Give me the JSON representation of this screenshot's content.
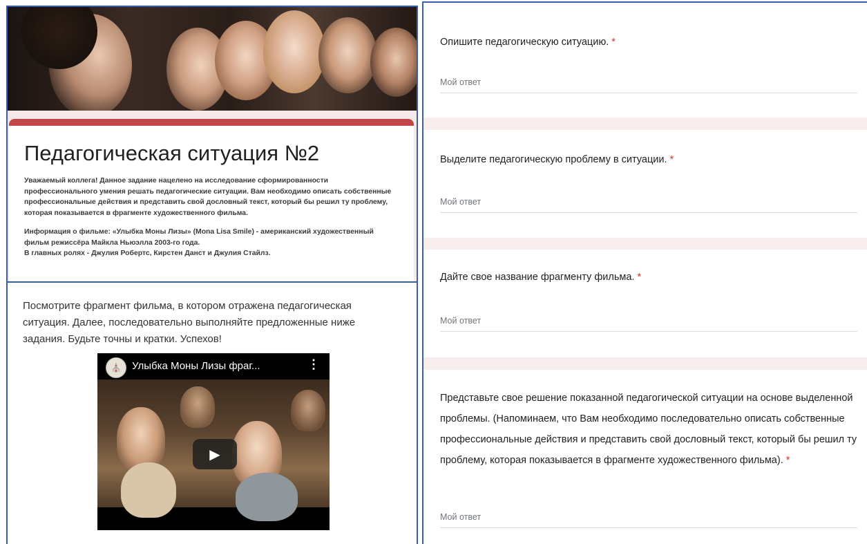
{
  "form": {
    "title": "Педагогическая ситуация №2",
    "description": [
      "Уважаемый коллега! Данное задание нацелено на исследование сформированности профессионального умения решать педагогические ситуации.   Вам необходимо описать собственные профессиональные действия и представить свой дословный текст, который бы решил ту проблему, которая показывается в фрагменте художественного фильма.",
      "Информация о фильме: «Улыбка Моны Лизы» (Mona Lisa Smile) - американский художественный фильм режиссёра Майкла Ньюэлла 2003-го года.\nВ главных ролях - Джулия Робертс, Кирстен Данст и Джулия Стайлз."
    ],
    "accent_color": "#c0464a"
  },
  "intro": {
    "text": "Посмотрите фрагмент фильма, в котором отражена педагогическая ситуация. Далее, последовательно выполняйте предложенные ниже задания. Будьте точны и кратки. Успехов!"
  },
  "video": {
    "title": "Улыбка Моны Лизы фраг...",
    "menu_icon": "more-vert-icon",
    "play_icon": "play-icon"
  },
  "questions": [
    {
      "label": "Опишите педагогическую ситуацию.",
      "required_mark": "*",
      "placeholder": "Мой ответ"
    },
    {
      "label": "Выделите педагогическую проблему в ситуации.",
      "required_mark": "*",
      "placeholder": "Мой ответ"
    },
    {
      "label": "Дайте свое название фрагменту фильма.",
      "required_mark": "*",
      "placeholder": "Мой ответ"
    },
    {
      "label": "Представьте свое решение показанной педагогической ситуации на основе выделенной проблемы. (Напоминаем, что Вам необходимо последовательно описать собственные профессиональные действия и представить свой дословный текст, который бы решил ту проблему, которая показывается в фрагменте художественного фильма).",
      "required_mark": "*",
      "placeholder": "Мой ответ"
    }
  ]
}
